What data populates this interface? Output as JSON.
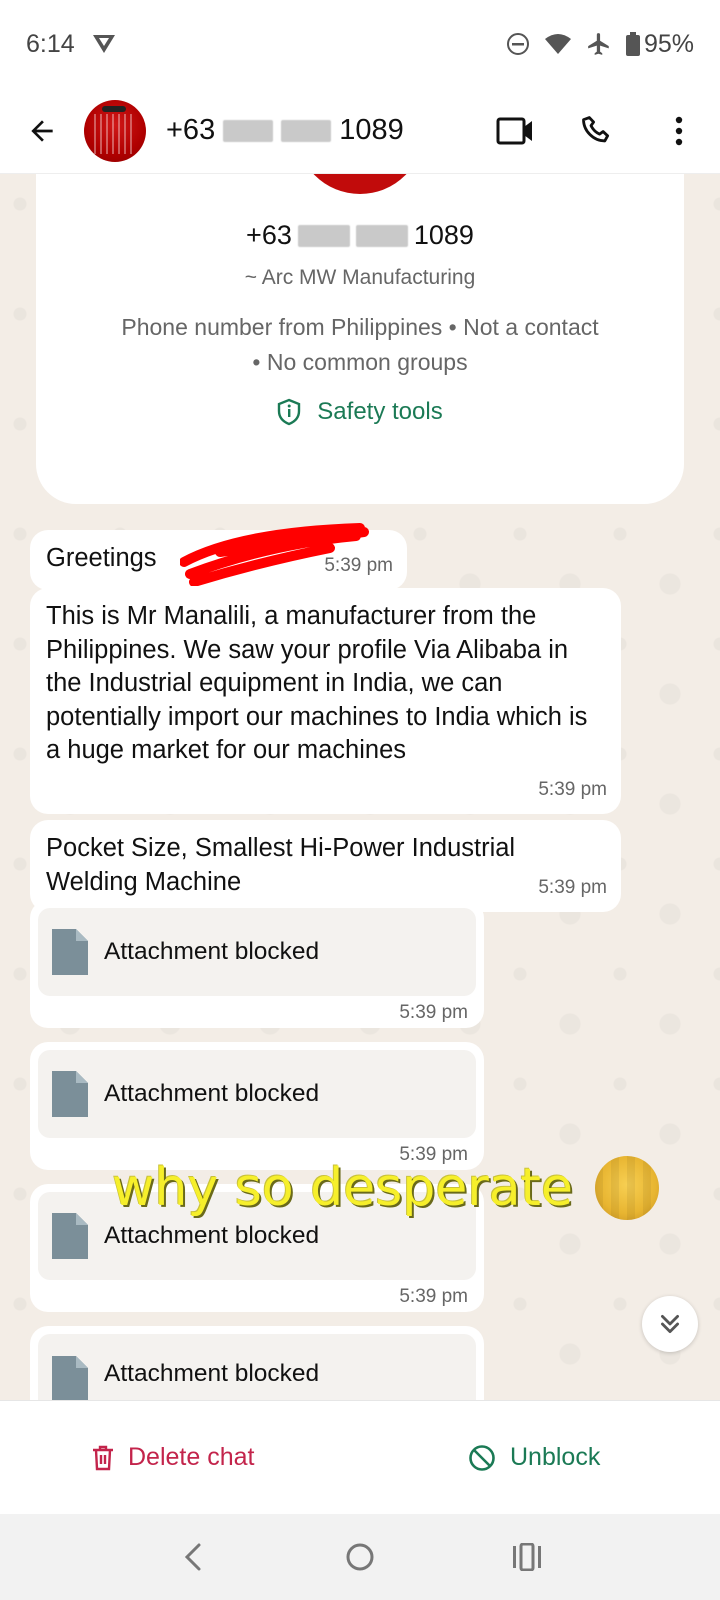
{
  "status_bar": {
    "time": "6:14",
    "battery": "95%",
    "icons": [
      "v-app-icon",
      "dnd-icon",
      "wifi-icon",
      "airplane-icon",
      "battery-icon"
    ]
  },
  "header": {
    "phone_prefix": "+63",
    "phone_suffix": "1089",
    "icons": [
      "back-arrow-icon",
      "video-call-icon",
      "phone-call-icon",
      "more-vert-icon"
    ]
  },
  "info_card": {
    "phone_prefix": "+63",
    "phone_suffix": "1089",
    "subname": "~ Arc MW Manufacturing",
    "meta_line1": "Phone number from Philippines • Not a contact",
    "meta_line2": "• No common groups",
    "safety_label": "Safety tools"
  },
  "messages": [
    {
      "text": "Greetings",
      "time": "5:39 pm"
    },
    {
      "text": "This is Mr Manalili, a manufacturer from the Philippines. We saw your profile Via Alibaba in the Industrial equipment in India, we can potentially import our machines to India which is a huge market for our machines",
      "time": "5:39 pm"
    },
    {
      "text": "Pocket Size, Smallest Hi-Power Industrial Welding Machine",
      "time": "5:39 pm"
    }
  ],
  "attachments": [
    {
      "label": "Attachment blocked",
      "time": "5:39 pm"
    },
    {
      "label": "Attachment blocked",
      "time": "5:39 pm"
    },
    {
      "label": "Attachment blocked",
      "time": "5:39 pm"
    },
    {
      "label": "Attachment blocked"
    }
  ],
  "overlay_caption": "why so desperate",
  "actions": {
    "delete_label": "Delete chat",
    "unblock_label": "Unblock"
  },
  "colors": {
    "chat_bg": "#f3ede6",
    "green": "#1b7a55",
    "red": "#c3244b",
    "overlay_yellow": "#f6ef2b"
  }
}
